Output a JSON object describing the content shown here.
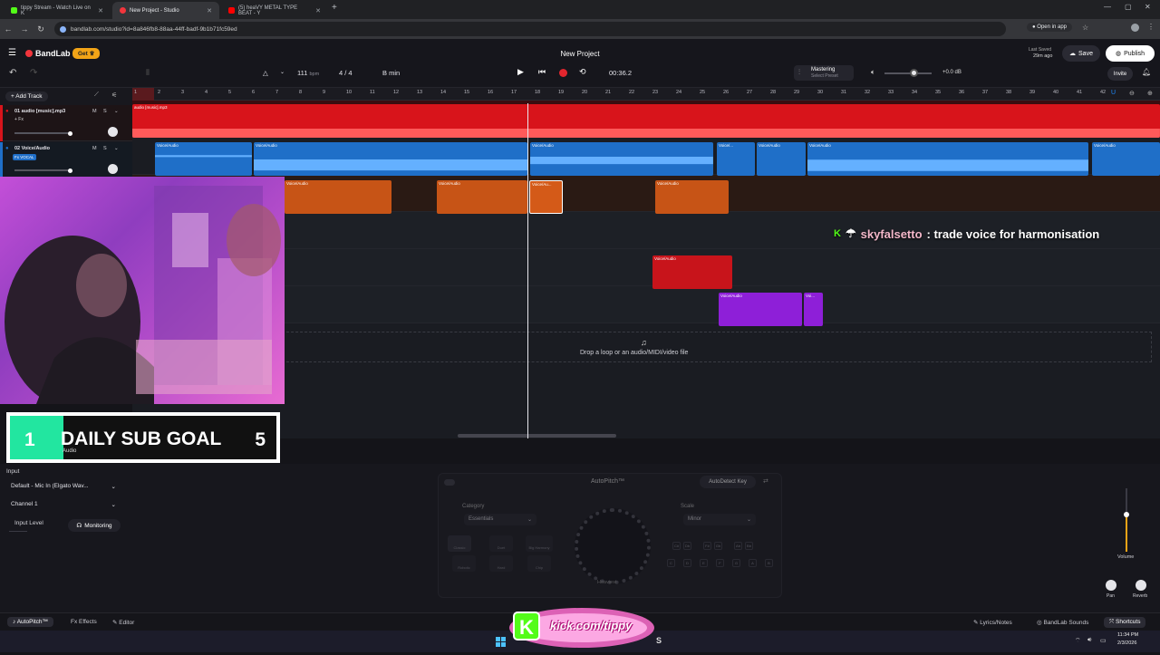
{
  "browser": {
    "tabs": [
      {
        "title": "tippy Stream - Watch Live on K",
        "favicon_color": "#53fc18",
        "active": false
      },
      {
        "title": "New Project - Studio",
        "favicon_color": "#f2353c",
        "active": true
      },
      {
        "title": "(5) heaVY METAL TYPE BEAT - Y",
        "favicon_color": "#ff0000",
        "active": false
      }
    ],
    "url": "bandlab.com/studio?id=8a846fb8-88aa-44ff-badf-9b1b71fc59ed",
    "open_in_app": "Open in app"
  },
  "header": {
    "logo": "BandLab",
    "get_label": "Get",
    "project_title": "New Project",
    "tempo": "111",
    "tempo_unit": "bpm",
    "time_signature": "4 / 4",
    "key": "B min",
    "time": "00:36.2",
    "mastering_title": "Mastering",
    "mastering_sub": "Select Preset",
    "volume_db": "+0.0 dB",
    "last_saved_label": "Last Saved",
    "last_saved_value": "29m ago",
    "save_label": "Save",
    "publish_label": "Publish",
    "invite_label": "Invite"
  },
  "tracks": {
    "add_track_label": "Add Track",
    "items": [
      {
        "name": "01 audio [music].mp3",
        "fx": "+ Fx",
        "mute": "M",
        "solo": "S"
      },
      {
        "name": "02 Voice/Audio",
        "fx": "Fx VOCAL",
        "mute": "M",
        "solo": "S"
      }
    ]
  },
  "timeline": {
    "bars": [
      "1",
      "2",
      "3",
      "4",
      "5",
      "6",
      "7",
      "8",
      "9",
      "10",
      "11",
      "12",
      "13",
      "14",
      "15",
      "16",
      "17",
      "18",
      "19",
      "20",
      "21",
      "22",
      "23",
      "24",
      "25",
      "26",
      "27",
      "28",
      "29",
      "30",
      "31",
      "32",
      "33",
      "34",
      "35",
      "36",
      "37",
      "38",
      "39",
      "40",
      "41",
      "42"
    ],
    "clip_label_music": "audio [music].mp3",
    "clip_label_voice": "Voice/Audio",
    "clip_label_short1": "Voice/...",
    "clip_label_short2": "Voi...",
    "clip_label_short3": "Voice/Au...",
    "drop_text": "Drop a loop or an audio/MIDI/video file",
    "track_colors": {
      "music": "#d8141b",
      "voice": "#1f6fc8",
      "orange": "#c75416",
      "red": "#c8141b",
      "purple": "#8e1fd8"
    }
  },
  "overlay": {
    "chat_user": "skyfalsetto",
    "chat_message": ": trade voice for harmonisation",
    "sub_goal": {
      "current": "1",
      "title": "DAILY SUB GOAL",
      "target": "5",
      "subtitle": "Audio",
      "progress": 0.2
    },
    "kick_url": "kick.com/tippy"
  },
  "input_panel": {
    "input_label": "Input",
    "input_device": "Default - Mic In (Elgato Wav...",
    "channel": "Channel 1",
    "input_level_label": "Input Level",
    "monitoring_label": "Monitoring"
  },
  "autopitch": {
    "title": "AutoPitch™",
    "autodetect_label": "AutoDetect Key",
    "category_label": "Category",
    "category_value": "Essentials",
    "scale_label": "Scale",
    "scale_value": "Minor",
    "presets": [
      "Classic",
      "Duet",
      "Big Harmony",
      "Robotic",
      "Hard",
      "Chip"
    ],
    "knob_label": "Heaviest",
    "keys_top": [
      "C#",
      "Db",
      "F#",
      "Gb",
      "Ab",
      "Bb"
    ],
    "keys_bottom": [
      "C",
      "D",
      "E",
      "F",
      "G",
      "A",
      "B"
    ]
  },
  "mix": {
    "volume_label": "Volume",
    "pan_label": "Pan",
    "reverb_label": "Reverb"
  },
  "bottom_tabs": {
    "autopitch": "AutoPitch™",
    "effects": "Effects",
    "editor": "Editor",
    "lyrics": "Lyrics/Notes",
    "sounds": "BandLab Sounds",
    "shortcuts": "Shortcuts"
  },
  "taskbar": {
    "time": "11:34 PM",
    "date": "2/3/2026"
  }
}
